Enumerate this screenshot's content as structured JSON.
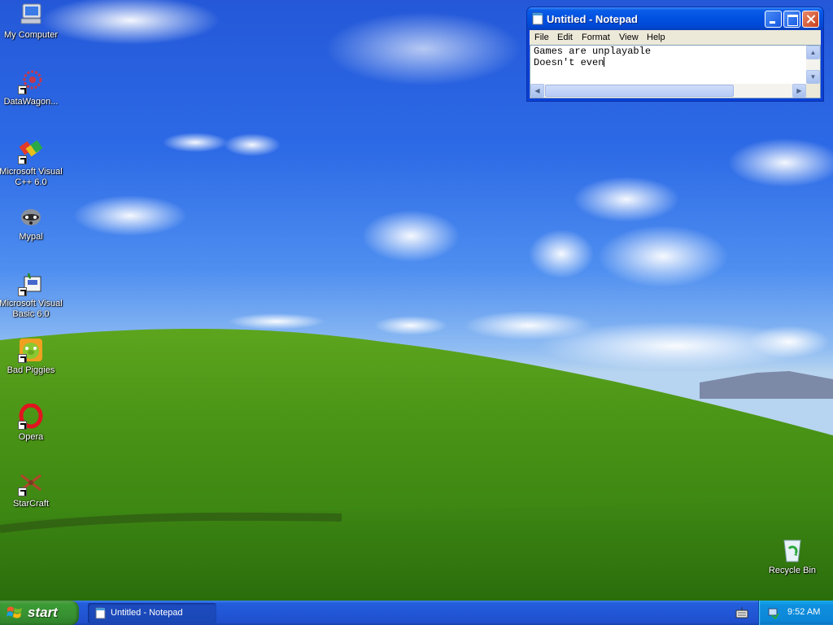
{
  "desktop": {
    "icons": [
      {
        "label": "My Computer",
        "icon": "my-computer-icon"
      },
      {
        "label": "DataWagon...",
        "icon": "datawagon-icon"
      },
      {
        "label": "Microsoft Visual C++ 6.0",
        "icon": "visual-cpp-icon"
      },
      {
        "label": "Mypal",
        "icon": "mypal-icon"
      },
      {
        "label": "Microsoft Visual Basic 6.0",
        "icon": "visual-basic-icon"
      },
      {
        "label": "Bad Piggies",
        "icon": "bad-piggies-icon"
      },
      {
        "label": "Opera",
        "icon": "opera-icon"
      },
      {
        "label": "StarCraft",
        "icon": "starcraft-icon"
      },
      {
        "label": "Recycle Bin",
        "icon": "recycle-bin-icon"
      }
    ]
  },
  "notepad": {
    "title": "Untitled - Notepad",
    "menu": [
      "File",
      "Edit",
      "Format",
      "View",
      "Help"
    ],
    "text_lines": [
      "Games are unplayable",
      "Doesn't even"
    ]
  },
  "taskbar": {
    "start_label": "start",
    "tasks": [
      {
        "label": "Untitled - Notepad"
      }
    ],
    "clock": "9:52 AM"
  },
  "colors": {
    "titlebar_blue": "#0050e0",
    "taskbar_blue": "#245edb",
    "start_green": "#3c9b35",
    "tray_blue": "#0f8fdf"
  }
}
